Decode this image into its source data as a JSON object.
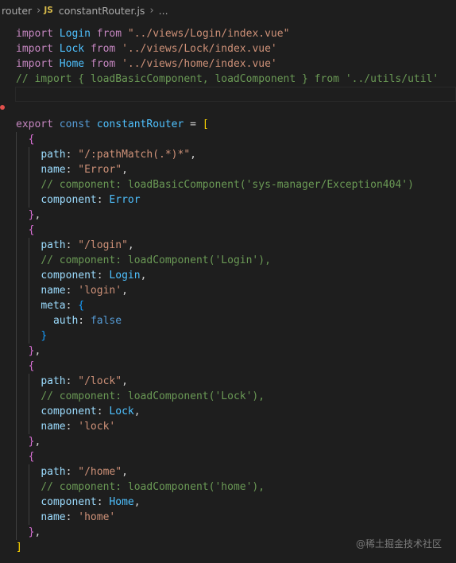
{
  "breadcrumb": {
    "folder": "router",
    "file_icon": "JS",
    "file": "constantRouter.js",
    "more": "..."
  },
  "editor": {
    "language": "javascript",
    "lines": [
      "import Login from \"../views/Login/index.vue\"",
      "import Lock from '../views/Lock/index.vue'",
      "import Home from '../views/home/index.vue'",
      "// import { loadBasicComponent, loadComponent } from '../utils/util'",
      "",
      "",
      "export const constantRouter = [",
      "  {",
      "    path: \"/:pathMatch(.*)*\",",
      "    name: \"Error\",",
      "    // component: loadBasicComponent('sys-manager/Exception404')",
      "    component: Error",
      "  },",
      "  {",
      "    path: \"/login\",",
      "    // component: loadComponent('Login'),",
      "    component: Login,",
      "    name: 'login',",
      "    meta: {",
      "      auth: false",
      "    }",
      "  },",
      "  {",
      "    path: \"/lock\",",
      "    // component: loadComponent('Lock'),",
      "    component: Lock,",
      "    name: 'lock'",
      "  },",
      "  {",
      "    path: \"/home\",",
      "    // component: loadComponent('home'),",
      "    component: Home,",
      "    name: 'home'",
      "  },",
      "]"
    ]
  },
  "watermark": "@稀土掘金技术社区",
  "colors": {
    "background": "#1e1e1e",
    "keyword": "#569cd6",
    "control_keyword": "#c586c0",
    "identifier": "#9cdcfe",
    "constant": "#4fc1ff",
    "string": "#ce9178",
    "comment": "#6a9955",
    "bracket_level1": "#ffd700",
    "bracket_level2": "#da70d6",
    "bracket_level3": "#179fff"
  }
}
